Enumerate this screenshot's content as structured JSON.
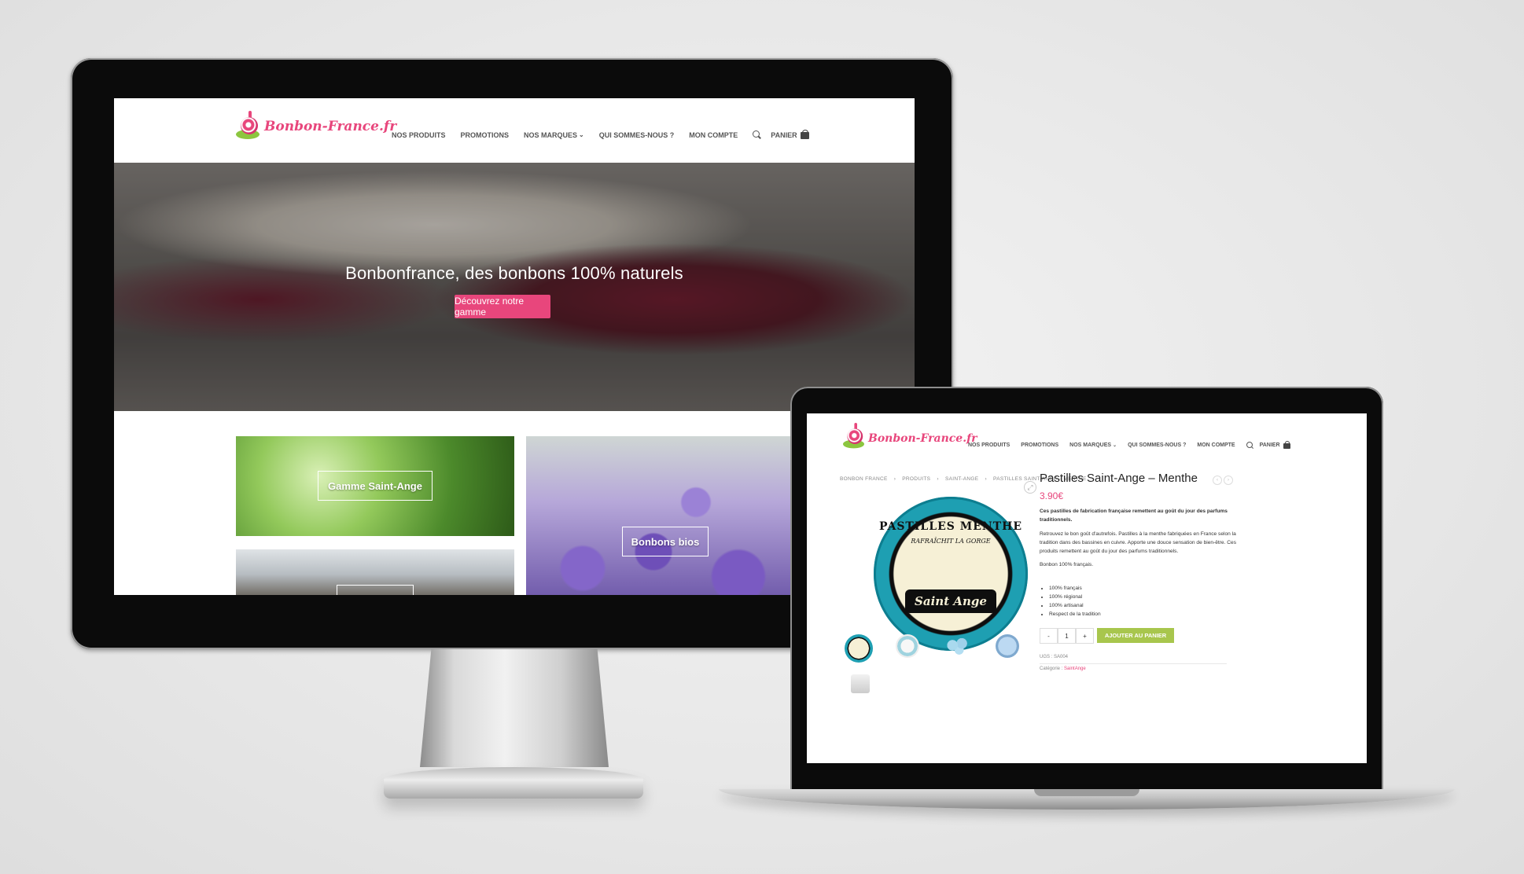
{
  "desktop": {
    "logo_text": "Bonbon-France.fr",
    "nav": [
      {
        "label": "NOS PRODUITS"
      },
      {
        "label": "PROMOTIONS"
      },
      {
        "label": "NOS MARQUES"
      },
      {
        "label": "QUI SOMMES-NOUS ?"
      },
      {
        "label": "MON COMPTE"
      }
    ],
    "cart_label": "PANIER",
    "hero": {
      "title": "Bonbonfrance, des bonbons 100% naturels",
      "button": "Découvrez notre gamme"
    },
    "tiles": [
      {
        "label": "Gamme Saint-Ange"
      },
      {
        "label": "Bonbons bios"
      }
    ]
  },
  "laptop": {
    "logo_text": "Bonbon-France.fr",
    "nav": [
      {
        "label": "NOS PRODUITS"
      },
      {
        "label": "PROMOTIONS"
      },
      {
        "label": "NOS MARQUES"
      },
      {
        "label": "QUI SOMMES-NOUS ?"
      },
      {
        "label": "MON COMPTE"
      }
    ],
    "cart_label": "PANIER",
    "breadcrumb": [
      "BONBON FRANCE",
      "›",
      "PRODUITS",
      "›",
      "SAINT-ANGE",
      "›",
      "PASTILLES SAINT-ANGE – MENTHE"
    ],
    "product": {
      "name": "Pastilles Saint-Ange – Menthe",
      "price": "3.90€",
      "intro": "Ces pastilles de fabrication française remettent au goût du jour des parfums traditionnels.",
      "description": "Retrouvez le bon goût d'autrefois. Pastilles à la menthe fabriquées en France selon la tradition dans des bassines en cuivre. Apporte une douce sensation de bien-être. Ces produits remettent au goût du jour des parfums traditionnels.",
      "origin": "Bonbon 100% français.",
      "features": [
        "100% français",
        "100% régional",
        "100% artisanal",
        "Respect de la tradition"
      ],
      "qty_minus": "-",
      "qty_value": "1",
      "qty_plus": "+",
      "add_to_cart": "AJOUTER AU PANIER",
      "sku": "UGS : SA004",
      "category_label": "Catégorie :",
      "category_value": "SaintAnge",
      "tin_top_text": "PASTILLES MENTHE",
      "tin_sub_text": "RAFRAÎCHIT LA GORGE",
      "tin_brand": "Saint Ange"
    }
  }
}
